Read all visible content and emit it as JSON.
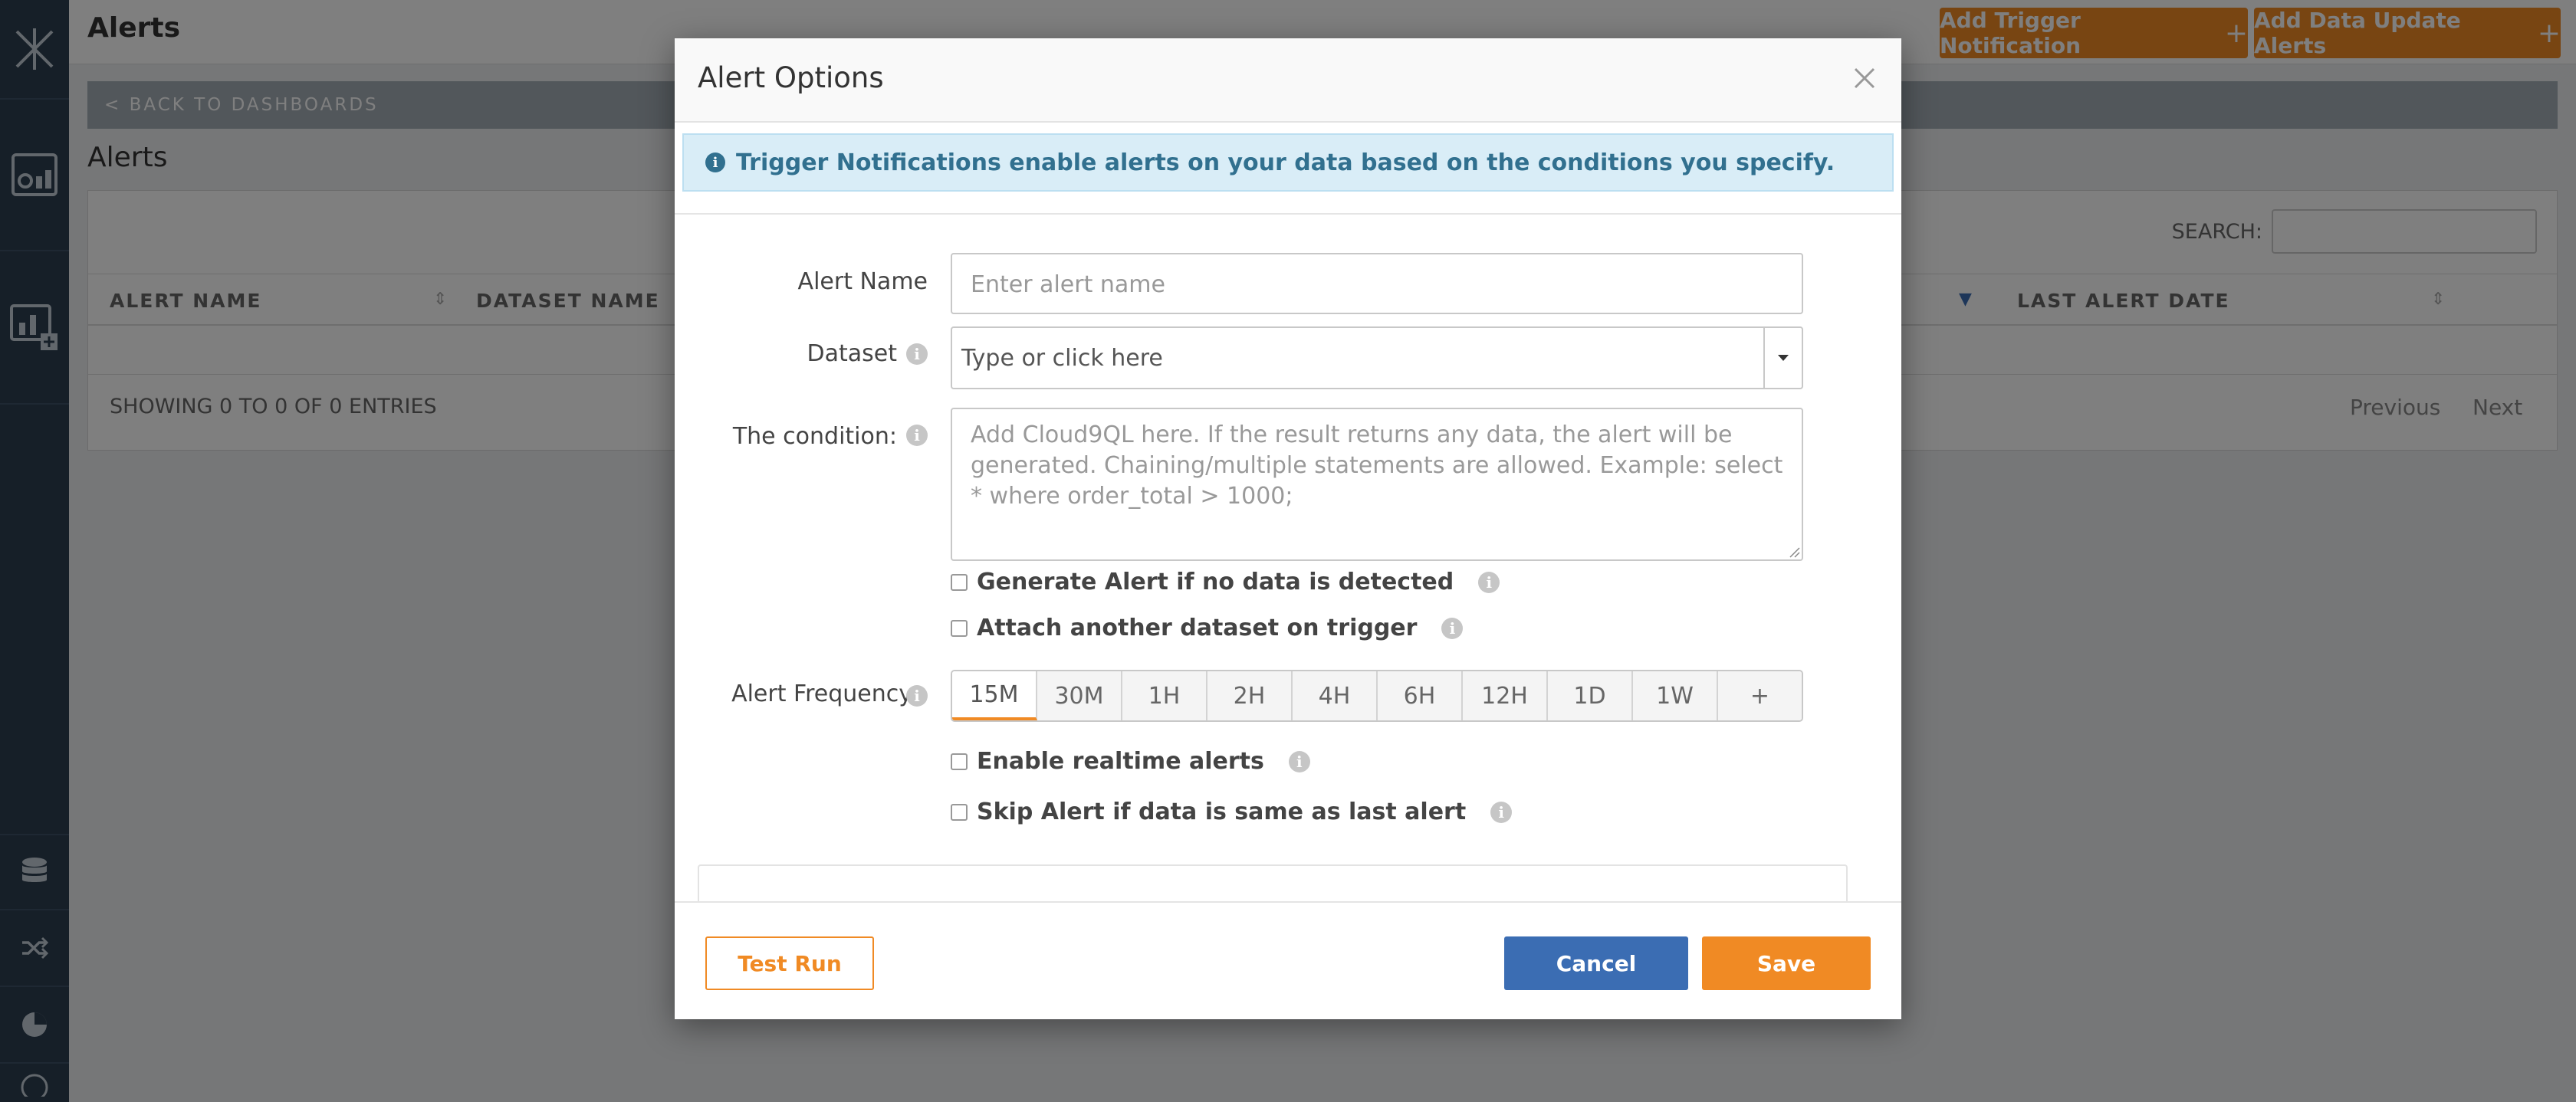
{
  "page": {
    "title": "Alerts",
    "header_buttons": [
      {
        "label": "Add Trigger Notification",
        "icon": "plus-icon"
      },
      {
        "label": "Add Data Update Alerts",
        "icon": "plus-icon"
      }
    ],
    "back_link": "< BACK TO DASHBOARDS",
    "section_title": "Alerts"
  },
  "table": {
    "search_label": "SEARCH:",
    "search_value": "",
    "columns": [
      "ALERT NAME",
      "DATASET NAME",
      "LAST ALERT DATE"
    ],
    "rows": [],
    "showing": "SHOWING 0 TO 0 OF 0 ENTRIES",
    "pager": {
      "previous": "Previous",
      "next": "Next"
    }
  },
  "modal": {
    "title": "Alert Options",
    "info": "Trigger Notifications enable alerts on your data based on the conditions you specify.",
    "fields": {
      "alert_name": {
        "label": "Alert Name",
        "placeholder": "Enter alert name",
        "value": ""
      },
      "dataset": {
        "label": "Dataset",
        "placeholder": "Type or click here"
      },
      "condition": {
        "label": "The condition:",
        "placeholder": "Add Cloud9QL here. If the result returns any data, the alert will be generated. Chaining/multiple statements are allowed.  Example: select * where order_total > 1000;"
      }
    },
    "checkboxes": [
      {
        "label": "Generate Alert if no data is detected",
        "checked": false
      },
      {
        "label": "Attach another dataset on trigger",
        "checked": false
      },
      {
        "label": "Enable realtime alerts",
        "checked": false
      },
      {
        "label": "Skip Alert if data is same as last alert",
        "checked": false
      }
    ],
    "frequency": {
      "label": "Alert Frequency",
      "options": [
        "15M",
        "30M",
        "1H",
        "2H",
        "4H",
        "6H",
        "12H",
        "1D",
        "1W",
        "+"
      ],
      "selected": "15M"
    },
    "buttons": {
      "test_run": "Test Run",
      "cancel": "Cancel",
      "save": "Save"
    }
  },
  "colors": {
    "sidebar": "#2c3e50",
    "accent": "#f08a24",
    "primary": "#3b6db3",
    "info_bg": "#d9edf7",
    "info_text": "#31708f"
  }
}
